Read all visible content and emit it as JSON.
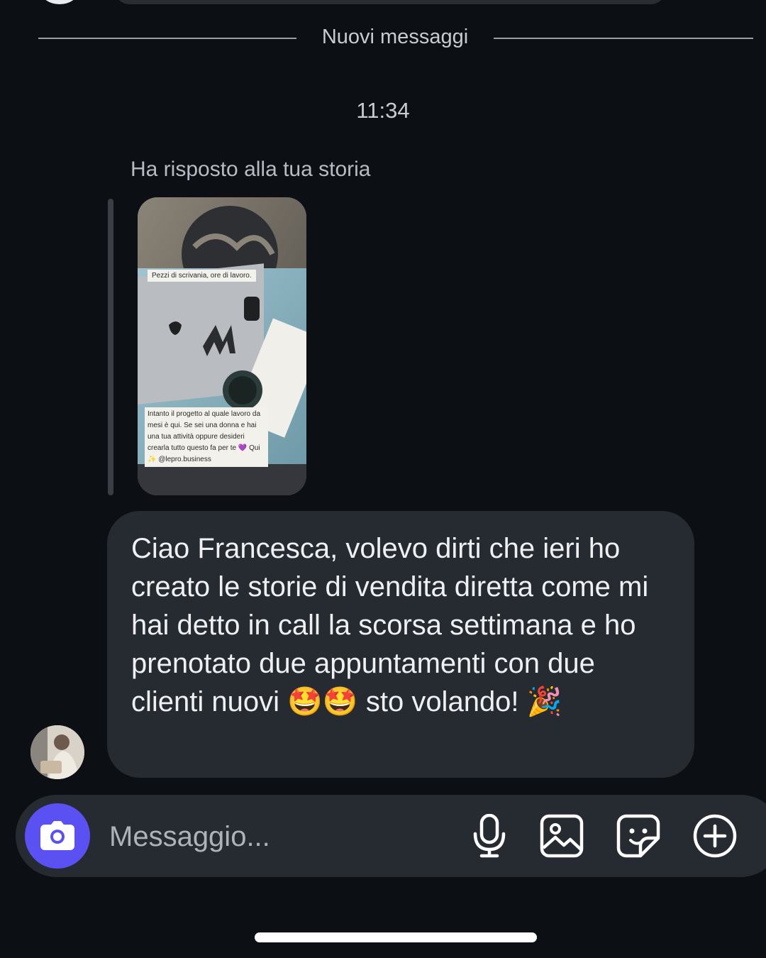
{
  "chat": {
    "divider_label": "Nuovi messaggi",
    "timestamp": "11:34",
    "reply_label": "Ha risposto alla tua storia",
    "story": {
      "caption_top": "Pezzi di scrivania, ore di lavoro.",
      "caption_bottom": "Intanto il progetto al quale lavoro da mesi è qui. Se sei una donna e hai una tua attività oppure desideri crearla tutto questo fa per te 💜 Qui ✨ @lepro.business"
    },
    "message": {
      "text": "Ciao Francesca, volevo dirti che ieri ho creato le storie di vendita diretta come mi hai detto in call la scorsa settimana e ho prenotato due appuntamenti con due clienti nuovi 🤩🤩 sto volando! 🎉"
    }
  },
  "composer": {
    "placeholder": "Messaggio...",
    "icons": [
      "camera-icon",
      "microphone-icon",
      "gallery-icon",
      "sticker-icon",
      "plus-circle-icon"
    ],
    "camera_color": "#5b51f3"
  },
  "colors": {
    "background": "#0c0f14",
    "bubble": "#262a31",
    "text": "#eef0f3",
    "muted": "#c8ccd2"
  }
}
